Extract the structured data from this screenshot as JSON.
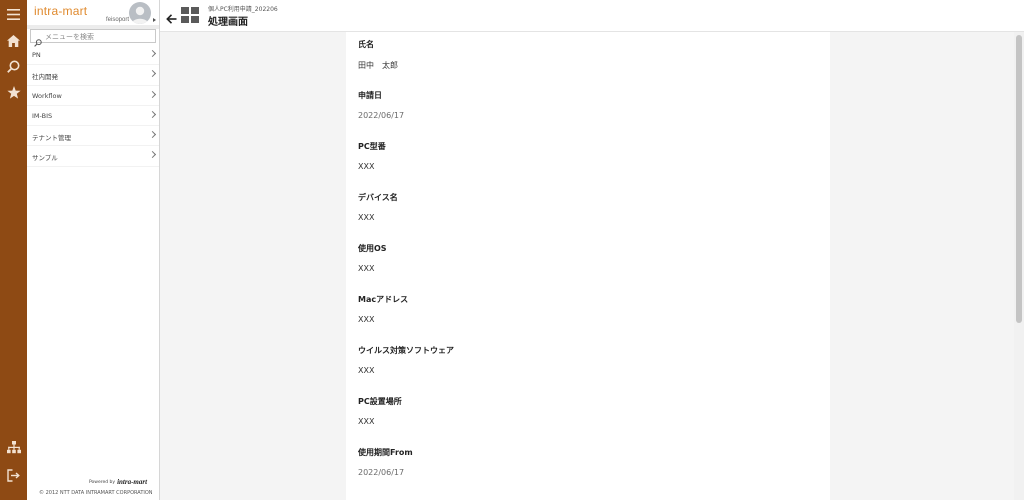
{
  "app": {
    "brand": "intra-mart",
    "username": "feisoport"
  },
  "search": {
    "placeholder": "メニューを検索"
  },
  "menu": {
    "items": [
      {
        "label": "PN"
      },
      {
        "label": "社内開発"
      },
      {
        "label": "Workflow"
      },
      {
        "label": "IM-BIS"
      },
      {
        "label": "テナント管理"
      },
      {
        "label": "サンプル"
      }
    ]
  },
  "footer": {
    "powered_by": "Powered by",
    "powered_logo": "intra-mart",
    "copyright": "© 2012 NTT DATA INTRAMART CORPORATION"
  },
  "header": {
    "sub_title": "個人PC利用申請_202206",
    "title": "処理画面"
  },
  "form": {
    "fields": [
      {
        "label": "氏名",
        "value": "田中　太郎"
      },
      {
        "label": "申請日",
        "value": "2022/06/17"
      },
      {
        "label": "PC型番",
        "value": "XXX"
      },
      {
        "label": "デバイス名",
        "value": "XXX"
      },
      {
        "label": "使用OS",
        "value": "XXX"
      },
      {
        "label": "Macアドレス",
        "value": "XXX"
      },
      {
        "label": "ウイルス対策ソフトウェア",
        "value": "XXX"
      },
      {
        "label": "PC設置場所",
        "value": "XXX"
      },
      {
        "label": "使用期間From",
        "value": "2022/06/17"
      }
    ]
  },
  "icons": {
    "rail_top": [
      "hamburger-icon",
      "home-icon",
      "search-icon",
      "star-icon"
    ],
    "rail_bottom": [
      "sitemap-icon",
      "logout-icon"
    ],
    "header": [
      "back-arrow-icon",
      "grid-icon"
    ]
  },
  "colors": {
    "rail": "#8e4a14",
    "brand": "#e08a2e"
  }
}
